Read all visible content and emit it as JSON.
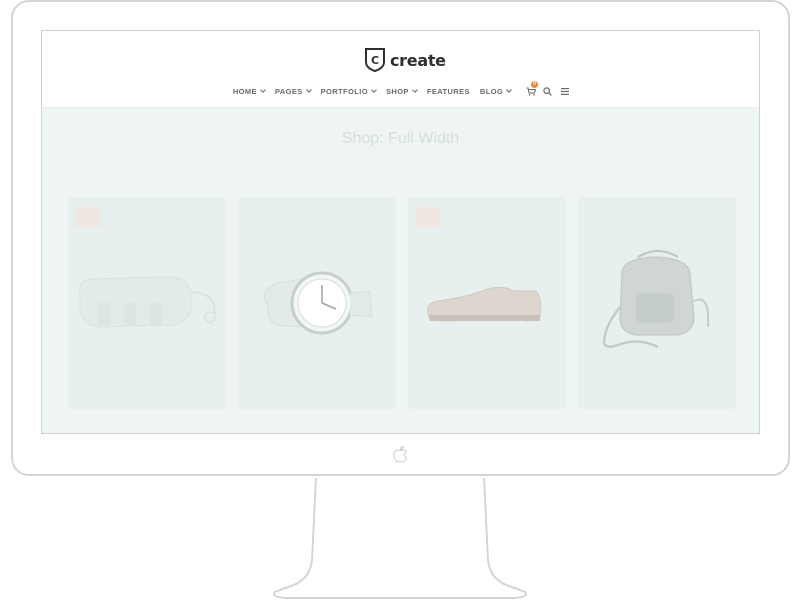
{
  "site": {
    "logo_text": "create",
    "logo_letter": "C"
  },
  "nav": {
    "items": [
      {
        "label": "HOME",
        "dropdown": true
      },
      {
        "label": "PAGES",
        "dropdown": true
      },
      {
        "label": "PORTFOLIO",
        "dropdown": true
      },
      {
        "label": "SHOP",
        "dropdown": true
      },
      {
        "label": "FEATURES",
        "dropdown": false
      },
      {
        "label": "BLOG",
        "dropdown": true
      }
    ],
    "cart_count": "0",
    "icons": [
      "cart-icon",
      "search-icon",
      "menu-icon"
    ]
  },
  "page": {
    "title": "Shop: Full Width"
  },
  "products": [
    {
      "image": "bag-product",
      "sale": true
    },
    {
      "image": "watch-product",
      "sale": false
    },
    {
      "image": "shoe-product",
      "sale": true
    },
    {
      "image": "backpack-product",
      "sale": false
    }
  ],
  "colors": {
    "shop_background": "#eef5f4",
    "badge": "#e08a3a",
    "frame": "#d4d4d4"
  }
}
